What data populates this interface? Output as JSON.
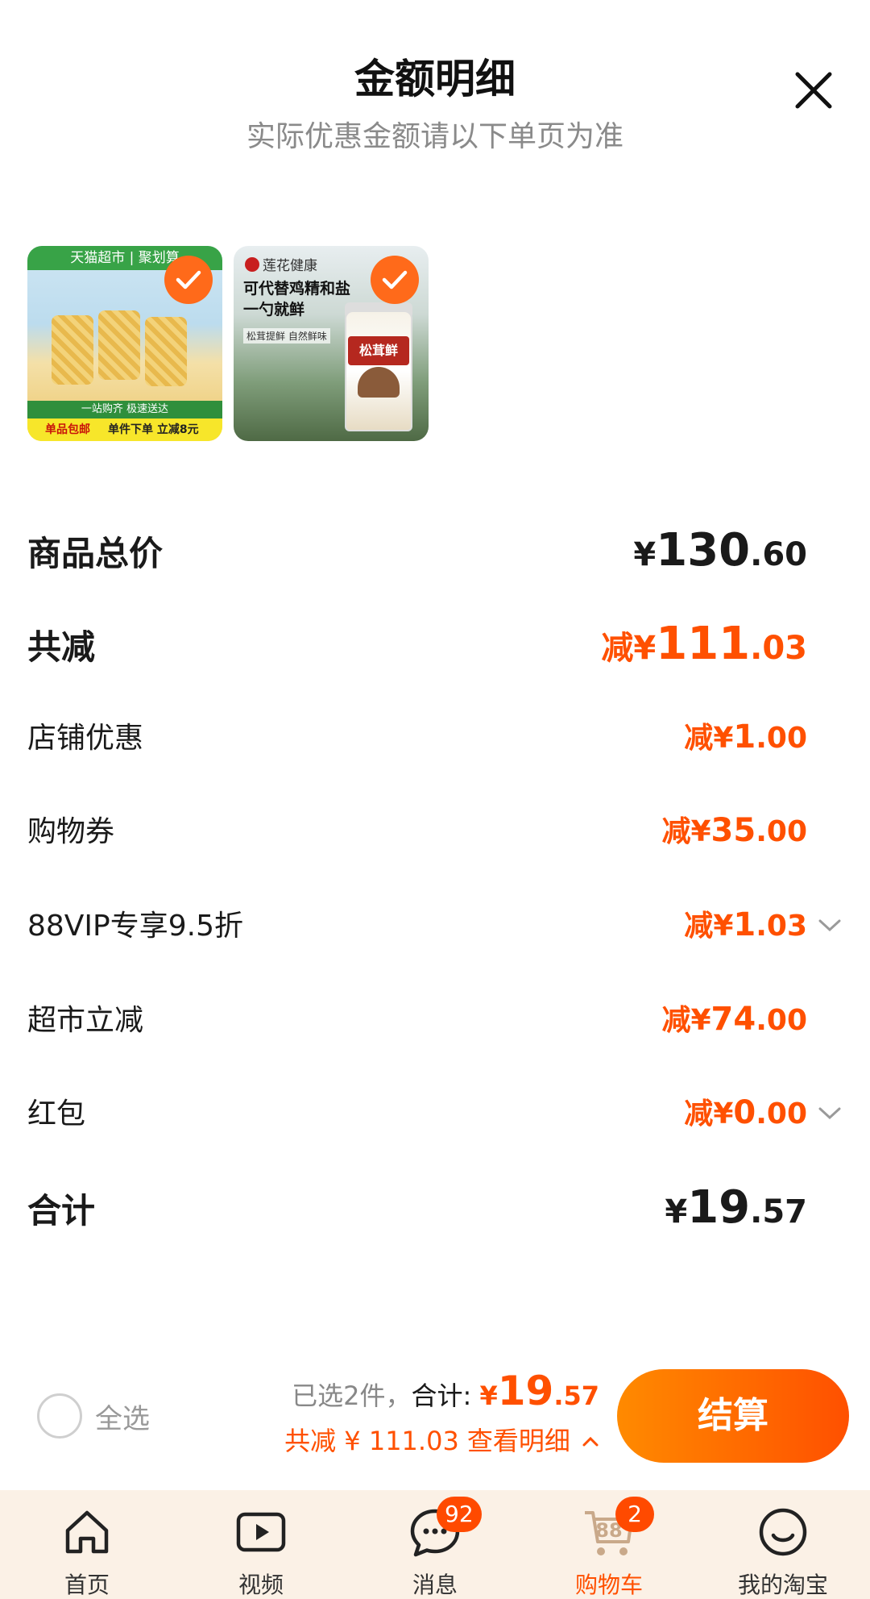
{
  "header": {
    "title": "金额明细",
    "subtitle": "实际优惠金额请以下单页为准"
  },
  "products": [
    {
      "top_banner": "天猫超市 | 聚划算",
      "bar_text": "一站购齐 极速送达",
      "badge": "单品包邮",
      "promo": "单件下单 立减8元",
      "selected": true
    },
    {
      "brand": "莲花健康",
      "headline": "可代替鸡精和盐 一勺就鲜",
      "tag": "松茸提鲜 自然鲜味",
      "jar_label": "松茸鲜",
      "selected": true
    }
  ],
  "breakdown": {
    "total": {
      "label": "商品总价",
      "cur": "¥",
      "int": "130",
      "dec": ".60"
    },
    "discount_total": {
      "label": "共减",
      "prefix": "减",
      "cur": "¥",
      "int": "111",
      "dec": ".03"
    },
    "items": [
      {
        "label": "店铺优惠",
        "prefix": "减",
        "cur": "¥",
        "int": "1",
        "dec": ".00",
        "expandable": false
      },
      {
        "label": "购物券",
        "prefix": "减",
        "cur": "¥",
        "int": "35",
        "dec": ".00",
        "expandable": false
      },
      {
        "label": "88VIP专享9.5折",
        "prefix": "减",
        "cur": "¥",
        "int": "1",
        "dec": ".03",
        "expandable": true
      },
      {
        "label": "超市立减",
        "prefix": "减",
        "cur": "¥",
        "int": "74",
        "dec": ".00",
        "expandable": false
      },
      {
        "label": "红包",
        "prefix": "减",
        "cur": "¥",
        "int": "0",
        "dec": ".00",
        "expandable": true
      }
    ],
    "grand_total": {
      "label": "合计",
      "cur": "¥",
      "int": "19",
      "dec": ".57"
    }
  },
  "checkout": {
    "select_all_label": "全选",
    "selected_count_text": "已选2件，",
    "sum_label": "合计:",
    "sum_cur": "¥",
    "sum_int": "19",
    "sum_dec": ".57",
    "discount_text": "共减 ¥ 111.03",
    "detail_link": "查看明细",
    "pay_button": "结算"
  },
  "tabbar": [
    {
      "label": "首页",
      "icon": "home-icon"
    },
    {
      "label": "视频",
      "icon": "video-icon"
    },
    {
      "label": "消息",
      "icon": "message-icon",
      "badge": "92"
    },
    {
      "label": "购物车",
      "icon": "cart-icon",
      "badge": "2",
      "cart_count": "88",
      "active": true
    },
    {
      "label": "我的淘宝",
      "icon": "profile-icon"
    }
  ],
  "colors": {
    "accent": "#ff5000",
    "button_gradient_start": "#ff8a00",
    "tabbar_bg": "#fbf1e6"
  }
}
